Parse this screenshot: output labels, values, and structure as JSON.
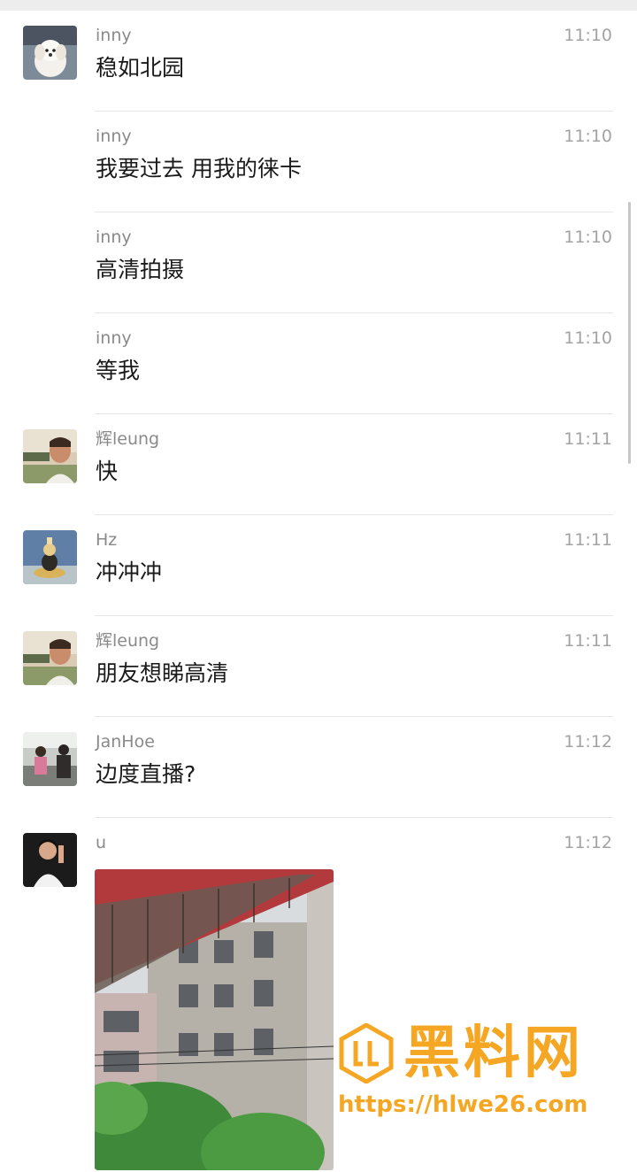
{
  "messages": [
    {
      "sender": "inny",
      "time": "11:10",
      "text": "稳如北园",
      "avatar": "dog-avatar",
      "show_avatar": true
    },
    {
      "sender": "inny",
      "time": "11:10",
      "text": "我要过去 用我的徕卡",
      "show_avatar": false
    },
    {
      "sender": "inny",
      "time": "11:10",
      "text": "高清拍摄",
      "show_avatar": false
    },
    {
      "sender": "inny",
      "time": "11:10",
      "text": "等我",
      "show_avatar": false
    },
    {
      "sender": "辉leung",
      "time": "11:11",
      "text": "快",
      "avatar": "man-avatar",
      "show_avatar": true
    },
    {
      "sender": "Hz",
      "time": "11:11",
      "text": "冲冲冲",
      "avatar": "figurine-avatar",
      "show_avatar": true
    },
    {
      "sender": "辉leung",
      "time": "11:11",
      "text": "朋友想睇高清",
      "avatar": "man-avatar",
      "show_avatar": true
    },
    {
      "sender": "JanHoe",
      "time": "11:12",
      "text": "边度直播?",
      "avatar": "people-avatar",
      "show_avatar": true
    },
    {
      "sender": "u",
      "time": "11:12",
      "avatar": "person-avatar",
      "show_avatar": true,
      "image": "building-photo"
    }
  ],
  "watermark": {
    "title": "黑料网",
    "url": "https://hlwe26.com"
  },
  "colors": {
    "text": "#1a1a1a",
    "meta": "#8a8a8a",
    "divider": "#e6e6e6",
    "watermark": "#f5a623"
  }
}
